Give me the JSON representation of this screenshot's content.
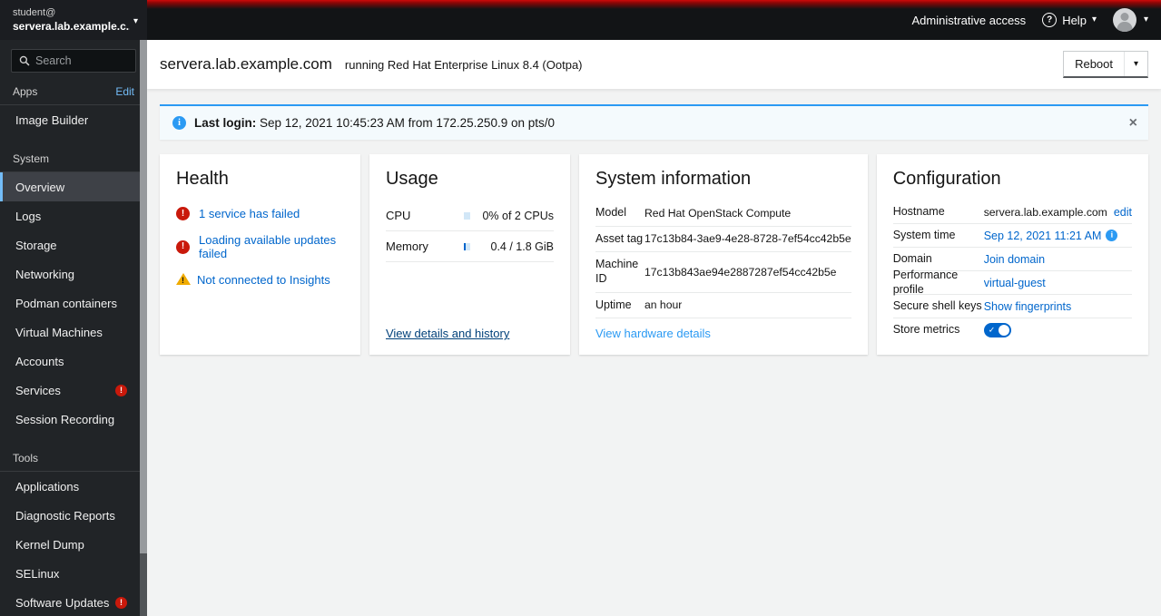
{
  "masthead": {
    "admin_access_label": "Administrative access",
    "help_label": "Help"
  },
  "sidebar": {
    "user": "student@",
    "host": "servera.lab.example.c...",
    "search_placeholder": "Search",
    "apps_group": {
      "label": "Apps",
      "action": "Edit",
      "items": [
        {
          "label": "Image Builder"
        }
      ]
    },
    "system_group": {
      "label": "System",
      "items": [
        {
          "label": "Overview"
        },
        {
          "label": "Logs"
        },
        {
          "label": "Storage"
        },
        {
          "label": "Networking"
        },
        {
          "label": "Podman containers"
        },
        {
          "label": "Virtual Machines"
        },
        {
          "label": "Accounts"
        },
        {
          "label": "Services"
        },
        {
          "label": "Session Recording"
        }
      ]
    },
    "tools_group": {
      "label": "Tools",
      "items": [
        {
          "label": "Applications"
        },
        {
          "label": "Diagnostic Reports"
        },
        {
          "label": "Kernel Dump"
        },
        {
          "label": "SELinux"
        },
        {
          "label": "Software Updates"
        }
      ]
    }
  },
  "page_header": {
    "hostname": "servera.lab.example.com",
    "os_text": "running Red Hat Enterprise Linux 8.4 (Ootpa)",
    "reboot_label": "Reboot"
  },
  "alert": {
    "title": "Last login:",
    "message": " Sep 12, 2021 10:45:23 AM from 172.25.250.9 on pts/0",
    "close_glyph": "×"
  },
  "cards": {
    "health": {
      "title": "Health",
      "items": [
        {
          "severity": "error",
          "text": "1 service has failed"
        },
        {
          "severity": "error",
          "text": "Loading available updates failed"
        },
        {
          "severity": "warning",
          "text": "Not connected to Insights"
        }
      ]
    },
    "usage": {
      "title": "Usage",
      "rows": [
        {
          "label": "CPU",
          "percent": 0,
          "value": "0% of 2 CPUs"
        },
        {
          "label": "Memory",
          "percent": 22,
          "value": "0.4 / 1.8 GiB"
        }
      ],
      "link": "View details and history"
    },
    "system_information": {
      "title": "System information",
      "rows": [
        {
          "label": "Model",
          "value": "Red Hat OpenStack Compute"
        },
        {
          "label": "Asset tag",
          "value": "17c13b84-3ae9-4e28-8728-7ef54cc42b5e"
        },
        {
          "label": "Machine ID",
          "value": "17c13b843ae94e2887287ef54cc42b5e"
        },
        {
          "label": "Uptime",
          "value": "an hour"
        }
      ],
      "link": "View hardware details"
    },
    "configuration": {
      "title": "Configuration",
      "rows": [
        {
          "label": "Hostname",
          "value": "servera.lab.example.com",
          "action": "edit"
        },
        {
          "label": "System time",
          "link": "Sep 12, 2021 11:21 AM"
        },
        {
          "label": "Domain",
          "link": "Join domain"
        },
        {
          "label": "Performance profile",
          "link": "virtual-guest"
        },
        {
          "label": "Secure shell keys",
          "link": "Show fingerprints"
        },
        {
          "label": "Store metrics",
          "toggle": "on"
        }
      ]
    }
  },
  "colors": {
    "masthead_red": "#cf0a0a",
    "error": "#c9190b",
    "warning": "#f0ab00",
    "info": "#2b9af3",
    "link": "#0066cc",
    "nav_active_border": "#73bcf7",
    "progress_track": "#d2e7f7",
    "progress_fill": "#0066cc"
  }
}
